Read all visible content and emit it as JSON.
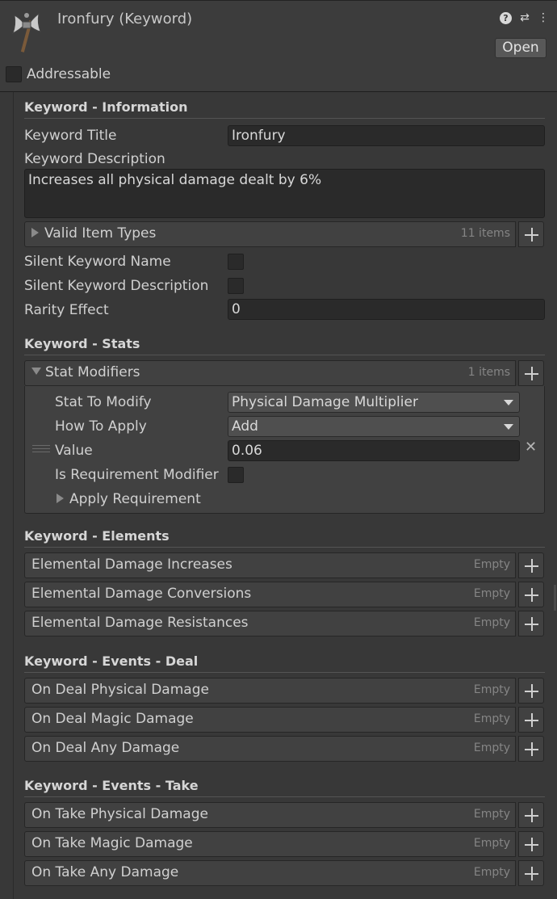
{
  "header": {
    "title": "Ironfury (Keyword)",
    "open_label": "Open",
    "addressable_label": "Addressable",
    "icons": [
      "help-icon",
      "settings-sliders-icon",
      "more-options-icon"
    ]
  },
  "information": {
    "title": "Keyword - Information",
    "keyword_title_label": "Keyword Title",
    "keyword_title_value": "Ironfury",
    "keyword_description_label": "Keyword Description",
    "keyword_description_value": "Increases all physical damage dealt by 6%",
    "valid_item_types_label": "Valid Item Types",
    "valid_item_types_count": "11 items",
    "silent_name_label": "Silent Keyword Name",
    "silent_description_label": "Silent Keyword Description",
    "rarity_effect_label": "Rarity Effect",
    "rarity_effect_value": "0"
  },
  "stats": {
    "title": "Keyword - Stats",
    "stat_modifiers_label": "Stat Modifiers",
    "stat_modifiers_count": "1 items",
    "stat_to_modify_label": "Stat To Modify",
    "stat_to_modify_value": "Physical Damage Multiplier",
    "how_to_apply_label": "How To Apply",
    "how_to_apply_value": "Add",
    "value_label": "Value",
    "value_value": "0.06",
    "is_requirement_label": "Is Requirement Modifier",
    "apply_requirement_label": "Apply Requirement"
  },
  "elements": {
    "title": "Keyword - Elements",
    "lists": [
      {
        "label": "Elemental Damage Increases",
        "count": "Empty"
      },
      {
        "label": "Elemental Damage Conversions",
        "count": "Empty"
      },
      {
        "label": "Elemental Damage Resistances",
        "count": "Empty"
      }
    ]
  },
  "events_deal": {
    "title": "Keyword - Events - Deal",
    "lists": [
      {
        "label": "On Deal Physical Damage",
        "count": "Empty"
      },
      {
        "label": "On Deal Magic Damage",
        "count": "Empty"
      },
      {
        "label": "On Deal Any Damage",
        "count": "Empty"
      }
    ]
  },
  "events_take": {
    "title": "Keyword - Events - Take",
    "lists": [
      {
        "label": "On Take Physical Damage",
        "count": "Empty"
      },
      {
        "label": "On Take Magic Damage",
        "count": "Empty"
      },
      {
        "label": "On Take Any Damage",
        "count": "Empty"
      }
    ]
  }
}
